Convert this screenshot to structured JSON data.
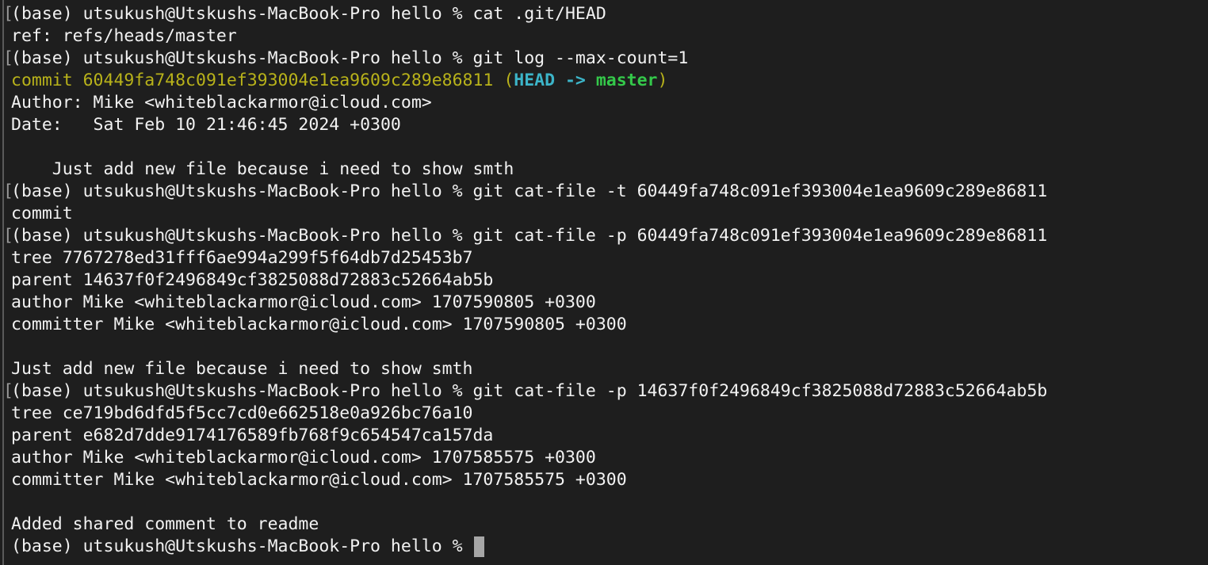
{
  "terminal": {
    "lines": [
      {
        "mark": "[",
        "text": "(base) utsukush@Utskushs-MacBook-Pro hello % cat .git/HEAD"
      },
      {
        "mark": "",
        "text": "ref: refs/heads/master"
      },
      {
        "mark": "[",
        "text": "(base) utsukush@Utskushs-MacBook-Pro hello % git log --max-count=1"
      },
      {
        "mark": "",
        "commit_prefix": "commit 60449fa748c091ef393004e1ea9609c289e86811 (",
        "head": "HEAD -> ",
        "branch": "master",
        "commit_suffix": ")"
      },
      {
        "mark": "",
        "text": "Author: Mike <whiteblackarmor@icloud.com>"
      },
      {
        "mark": "",
        "text": "Date:   Sat Feb 10 21:46:45 2024 +0300"
      },
      {
        "mark": "",
        "text": ""
      },
      {
        "mark": "",
        "text": "    Just add new file because i need to show smth"
      },
      {
        "mark": "[",
        "text": "(base) utsukush@Utskushs-MacBook-Pro hello % git cat-file -t 60449fa748c091ef393004e1ea9609c289e86811"
      },
      {
        "mark": "",
        "text": "commit"
      },
      {
        "mark": "[",
        "text": "(base) utsukush@Utskushs-MacBook-Pro hello % git cat-file -p 60449fa748c091ef393004e1ea9609c289e86811"
      },
      {
        "mark": "",
        "text": "tree 7767278ed31fff6ae994a299f5f64db7d25453b7"
      },
      {
        "mark": "",
        "text": "parent 14637f0f2496849cf3825088d72883c52664ab5b"
      },
      {
        "mark": "",
        "text": "author Mike <whiteblackarmor@icloud.com> 1707590805 +0300"
      },
      {
        "mark": "",
        "text": "committer Mike <whiteblackarmor@icloud.com> 1707590805 +0300"
      },
      {
        "mark": "",
        "text": ""
      },
      {
        "mark": "",
        "text": "Just add new file because i need to show smth"
      },
      {
        "mark": "[",
        "text": "(base) utsukush@Utskushs-MacBook-Pro hello % git cat-file -p 14637f0f2496849cf3825088d72883c52664ab5b"
      },
      {
        "mark": "",
        "text": "tree ce719bd6dfd5f5cc7cd0e662518e0a926bc76a10"
      },
      {
        "mark": "",
        "text": "parent e682d7dde9174176589fb768f9c654547ca157da"
      },
      {
        "mark": "",
        "text": "author Mike <whiteblackarmor@icloud.com> 1707585575 +0300"
      },
      {
        "mark": "",
        "text": "committer Mike <whiteblackarmor@icloud.com> 1707585575 +0300"
      },
      {
        "mark": "",
        "text": ""
      },
      {
        "mark": "",
        "text": "Added shared comment to readme"
      },
      {
        "mark": "",
        "text": "(base) utsukush@Utskushs-MacBook-Pro hello % "
      }
    ]
  },
  "colors": {
    "background": "#1e1e1e",
    "foreground": "#f2f2f2",
    "commit_yellow": "#b8b21a",
    "head_cyan": "#3cb5c9",
    "branch_green": "#34c84a",
    "cursor": "#a6a6a6"
  }
}
